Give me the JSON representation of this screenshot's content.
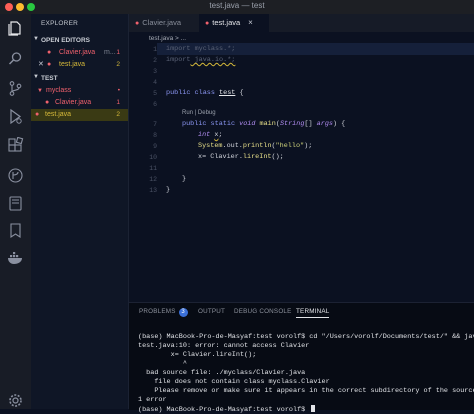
{
  "window": {
    "title": "test.java — test"
  },
  "activity_bar": {
    "icons": [
      "files-icon",
      "search-icon",
      "source-control-icon",
      "run-debug-icon",
      "extensions-icon",
      "gitlens-icon",
      "remote-explorer-icon",
      "bookmarks-icon",
      "docker-icon",
      "settings-gear-icon"
    ]
  },
  "sidebar": {
    "title": "EXPLORER",
    "open_editors": {
      "label": "OPEN EDITORS",
      "items": [
        {
          "name": "Clavier.java",
          "path": "m...",
          "badge": "1"
        },
        {
          "name": "test.java",
          "badge": "2",
          "close": "✕"
        }
      ]
    },
    "workspace": {
      "label": "TEST",
      "folder": "myclass",
      "folder_badge": "•",
      "files": [
        {
          "name": "Clavier.java",
          "badge": "1"
        },
        {
          "name": "test.java",
          "badge": "2"
        }
      ]
    }
  },
  "editor": {
    "tabs": [
      {
        "label": "Clavier.java"
      },
      {
        "label": "test.java",
        "close": "×"
      }
    ],
    "breadcrumb": "test.java > ...",
    "codelens": "Run | Debug",
    "line_numbers": [
      "1",
      "2",
      "3",
      "4",
      "5",
      "6",
      "7",
      "8",
      "9",
      "10",
      "11",
      "12",
      "13"
    ],
    "code": {
      "l1_kw": "import",
      "l1_rest": " myclass.*;",
      "l2_kw": "import",
      "l2_rest": " java.io.*;",
      "l4_a": "public class ",
      "l4_b": "test",
      "l4_c": " {",
      "l7_a": "public static ",
      "l7_b": "void",
      "l7_c": " main",
      "l7_d": "(",
      "l7_e": "String",
      "l7_f": "[] ",
      "l7_g": "args",
      "l7_h": ") {",
      "l8_a": "int ",
      "l8_b": "x",
      "l8_c": ";",
      "l9_a": "System",
      "l9_b": ".out.",
      "l9_c": "println",
      "l9_d": "(",
      "l9_e": "\"hello\"",
      "l9_f": ");",
      "l10_a": "x",
      "l10_b": "= ",
      "l10_c": "Clavier",
      "l10_d": ".",
      "l10_e": "lireInt",
      "l10_f": "();",
      "l12": "}",
      "l13": "}"
    }
  },
  "panel": {
    "tabs": [
      {
        "label": "PROBLEMS",
        "badge": "3"
      },
      {
        "label": "OUTPUT"
      },
      {
        "label": "DEBUG CONSOLE"
      },
      {
        "label": "TERMINAL"
      }
    ],
    "terminal_lines": [
      "(base) MacBook-Pro-de-Masyaf:test vorolf$ cd \"/Users/vorolf/Documents/test/\" && javac",
      "test.java:10: error: cannot access Clavier",
      "        x= Clavier.lireInt();",
      "           ^",
      "  bad source file: ./myclass/Clavier.java",
      "    file does not contain class myclass.Clavier",
      "    Please remove or make sure it appears in the correct subdirectory of the sourcepat",
      "1 error",
      "(base) MacBook-Pro-de-Masyaf:test vorolf$ "
    ]
  },
  "colors": {
    "background": "#0b1121",
    "error_red": "#f0616d",
    "warning_gold": "#d7ba3a",
    "keyword": "#8b96f2"
  }
}
